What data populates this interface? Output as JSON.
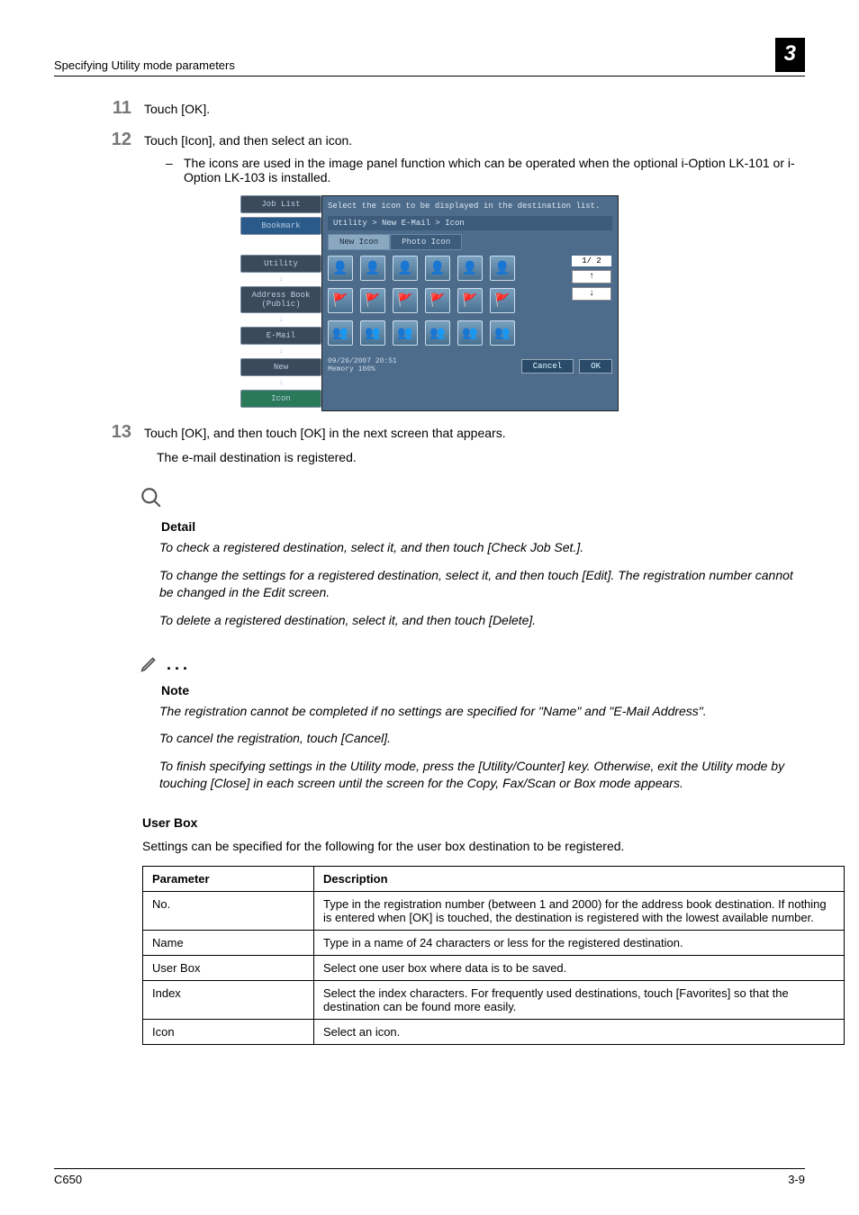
{
  "header": {
    "running": "Specifying Utility mode parameters",
    "chapter": "3"
  },
  "steps": {
    "s11": {
      "num": "11",
      "text": "Touch [OK]."
    },
    "s12": {
      "num": "12",
      "text": "Touch [Icon], and then select an icon.",
      "sub_dash": "–",
      "sub": "The icons are used in the image panel function which can be operated when the optional i-Option LK-101 or i-Option LK-103 is installed."
    },
    "s13": {
      "num": "13",
      "text": "Touch [OK], and then touch [OK] in the next screen that appears.",
      "after": "The e-mail destination is registered."
    }
  },
  "screenshot": {
    "hint": "Select the icon to be displayed in the destination list.",
    "crumb": "Utility > New E-Mail > Icon",
    "tabs": {
      "new": "New Icon",
      "photo": "Photo Icon"
    },
    "sidebar": {
      "joblist": "Job List",
      "bookmark": "Bookmark",
      "utility": "Utility",
      "addrbook": "Address Book (Public)",
      "email": "E-Mail",
      "new": "New",
      "icon": "Icon"
    },
    "page_indicator": "1/  2",
    "up": "↑",
    "down": "↓",
    "timestamp_line1": "09/26/2007   20:51",
    "timestamp_line2": "Memory       100%",
    "cancel": "Cancel",
    "ok": "OK",
    "emoji_person": "👤",
    "emoji_flag": "🚩",
    "emoji_group": "👥"
  },
  "detail": {
    "title": "Detail",
    "p1": "To check a registered destination, select it, and then touch [Check Job Set.].",
    "p2": "To change the settings for a registered destination, select it, and then touch [Edit]. The registration number cannot be changed in the Edit screen.",
    "p3": "To delete a registered destination, select it, and then touch [Delete]."
  },
  "note": {
    "title": "Note",
    "p1": "The registration cannot be completed if no settings are specified for \"Name\" and \"E-Mail Address\".",
    "p2": "To cancel the registration, touch [Cancel].",
    "p3": "To finish specifying settings in the Utility mode, press the [Utility/Counter] key. Otherwise, exit the Utility mode by touching [Close] in each screen until the screen for the Copy, Fax/Scan or Box mode appears."
  },
  "userbox": {
    "heading": "User Box",
    "intro": "Settings can be specified for the following for the user box destination to be registered.",
    "th_param": "Parameter",
    "th_desc": "Description",
    "rows": {
      "no": {
        "p": "No.",
        "d": "Type in the registration number (between 1 and 2000) for the address book destination. If nothing is entered when [OK] is touched, the destination is registered with the lowest available number."
      },
      "name": {
        "p": "Name",
        "d": "Type in a name of 24 characters or less for the registered destination."
      },
      "ubox": {
        "p": "User Box",
        "d": "Select one user box where data is to be saved."
      },
      "index": {
        "p": "Index",
        "d": "Select the index characters. For frequently used destinations, touch [Favorites] so that the destination can be found more easily."
      },
      "icon": {
        "p": "Icon",
        "d": "Select an icon."
      }
    }
  },
  "footer": {
    "left": "C650",
    "right": "3-9"
  }
}
